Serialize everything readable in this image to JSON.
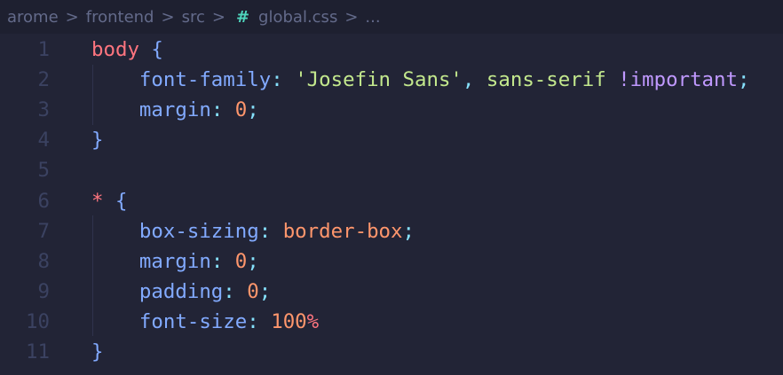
{
  "breadcrumb": {
    "items": [
      "arome",
      "frontend",
      "src"
    ],
    "file_icon": "css-hash-icon",
    "file": "global.css",
    "more": "..."
  },
  "colors": {
    "selector": "#ff757f",
    "brace": "#82aaff",
    "property": "#82aaff",
    "punct": "#86e1fc",
    "string": "#c3e88d",
    "number": "#ff966c",
    "important": "#c099ff",
    "unit": "#ff757f"
  },
  "lines": [
    {
      "n": "1",
      "tokens": [
        [
          "body",
          "selector"
        ],
        [
          " ",
          ""
        ],
        [
          "{",
          "brace"
        ]
      ]
    },
    {
      "n": "2",
      "tokens": [
        [
          "    ",
          ""
        ],
        [
          "font-family",
          "property"
        ],
        [
          ":",
          "punct"
        ],
        [
          " ",
          ""
        ],
        [
          "'Josefin Sans'",
          "string"
        ],
        [
          ",",
          "punct"
        ],
        [
          " ",
          ""
        ],
        [
          "sans-serif",
          "string"
        ],
        [
          " ",
          ""
        ],
        [
          "!important",
          "important"
        ],
        [
          ";",
          "punct"
        ]
      ]
    },
    {
      "n": "3",
      "tokens": [
        [
          "    ",
          ""
        ],
        [
          "margin",
          "property"
        ],
        [
          ":",
          "punct"
        ],
        [
          " ",
          ""
        ],
        [
          "0",
          "number"
        ],
        [
          ";",
          "punct"
        ]
      ]
    },
    {
      "n": "4",
      "tokens": [
        [
          "}",
          "brace"
        ]
      ]
    },
    {
      "n": "5",
      "tokens": []
    },
    {
      "n": "6",
      "tokens": [
        [
          "*",
          "selector"
        ],
        [
          " ",
          ""
        ],
        [
          "{",
          "brace"
        ]
      ]
    },
    {
      "n": "7",
      "tokens": [
        [
          "    ",
          ""
        ],
        [
          "box-sizing",
          "property"
        ],
        [
          ":",
          "punct"
        ],
        [
          " ",
          ""
        ],
        [
          "border-box",
          "number"
        ],
        [
          ";",
          "punct"
        ]
      ]
    },
    {
      "n": "8",
      "tokens": [
        [
          "    ",
          ""
        ],
        [
          "margin",
          "property"
        ],
        [
          ":",
          "punct"
        ],
        [
          " ",
          ""
        ],
        [
          "0",
          "number"
        ],
        [
          ";",
          "punct"
        ]
      ]
    },
    {
      "n": "9",
      "tokens": [
        [
          "    ",
          ""
        ],
        [
          "padding",
          "property"
        ],
        [
          ":",
          "punct"
        ],
        [
          " ",
          ""
        ],
        [
          "0",
          "number"
        ],
        [
          ";",
          "punct"
        ]
      ]
    },
    {
      "n": "10",
      "tokens": [
        [
          "    ",
          ""
        ],
        [
          "font-size",
          "property"
        ],
        [
          ":",
          "punct"
        ],
        [
          " ",
          ""
        ],
        [
          "100",
          "number"
        ],
        [
          "%",
          "unit"
        ]
      ]
    },
    {
      "n": "11",
      "tokens": [
        [
          "}",
          "brace"
        ]
      ]
    }
  ]
}
